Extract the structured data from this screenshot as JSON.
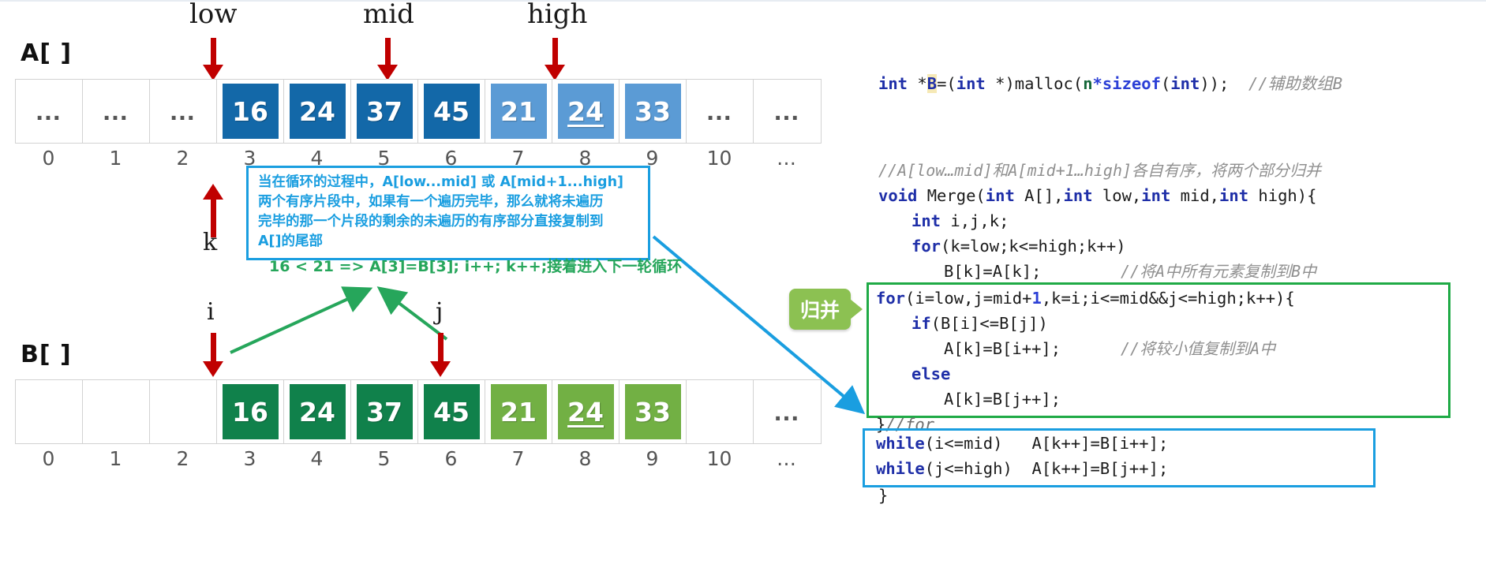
{
  "arrays": {
    "a": {
      "label": "A[ ]",
      "cells": [
        {
          "text": "…",
          "type": "dots"
        },
        {
          "text": "…",
          "type": "dots"
        },
        {
          "text": "…",
          "type": "dots"
        },
        {
          "text": "16",
          "type": "chip",
          "color": "#1368a8",
          "underline": false
        },
        {
          "text": "24",
          "type": "chip",
          "color": "#1368a8",
          "underline": false
        },
        {
          "text": "37",
          "type": "chip",
          "color": "#1368a8",
          "underline": false
        },
        {
          "text": "45",
          "type": "chip",
          "color": "#1368a8",
          "underline": false
        },
        {
          "text": "21",
          "type": "chip",
          "color": "#5b9bd5",
          "underline": false
        },
        {
          "text": "24",
          "type": "chip",
          "color": "#5b9bd5",
          "underline": true
        },
        {
          "text": "33",
          "type": "chip",
          "color": "#5b9bd5",
          "underline": false
        },
        {
          "text": "…",
          "type": "dots"
        },
        {
          "text": "…",
          "type": "dots"
        }
      ],
      "indices": [
        "0",
        "1",
        "2",
        "3",
        "4",
        "5",
        "6",
        "7",
        "8",
        "9",
        "10",
        "…"
      ]
    },
    "b": {
      "label": "B[ ]",
      "cells": [
        {
          "text": "",
          "type": "empty"
        },
        {
          "text": "",
          "type": "empty"
        },
        {
          "text": "",
          "type": "empty"
        },
        {
          "text": "16",
          "type": "chip",
          "color": "#10814b",
          "underline": false
        },
        {
          "text": "24",
          "type": "chip",
          "color": "#10814b",
          "underline": false
        },
        {
          "text": "37",
          "type": "chip",
          "color": "#10814b",
          "underline": false
        },
        {
          "text": "45",
          "type": "chip",
          "color": "#10814b",
          "underline": false
        },
        {
          "text": "21",
          "type": "chip",
          "color": "#72b044",
          "underline": false
        },
        {
          "text": "24",
          "type": "chip",
          "color": "#72b044",
          "underline": true
        },
        {
          "text": "33",
          "type": "chip",
          "color": "#72b044",
          "underline": false
        },
        {
          "text": "",
          "type": "empty"
        },
        {
          "text": "…",
          "type": "dots"
        }
      ],
      "indices": [
        "0",
        "1",
        "2",
        "3",
        "4",
        "5",
        "6",
        "7",
        "8",
        "9",
        "10",
        "…"
      ]
    }
  },
  "pointers": {
    "low": "low",
    "mid": "mid",
    "high": "high",
    "k": "k",
    "i": "i",
    "j": "j"
  },
  "notes": {
    "blue_box": {
      "line1": "当在循环的过程中，A[low...mid] 或 A[mid+1...high]",
      "line2": "两个有序片段中，如果有一个遍历完毕，那么就将未遍历",
      "line3": "完毕的那一个片段的剩余的未遍历的有序部分直接复制到",
      "line4": "A[]的尾部"
    },
    "green_equation": "16 < 21 => A[3]=B[3]; i++; k++;接着进入下一轮循环",
    "merge_tag": "归并"
  },
  "code": {
    "line_malloc": {
      "kw1": "int",
      "star_b": " *B",
      "eq": "=(",
      "kw2": "int",
      "cast": " *)malloc(",
      "n": "n",
      "mul": "*",
      "sizeof": "sizeof",
      "open": "(",
      "kw3": "int",
      "close": "));",
      "comment": " //辅助数组B"
    },
    "comment_merge": "//A[low…mid]和A[mid+1…high]各自有序，将两个部分归并",
    "sig": {
      "kw_void": "void",
      "name": " Merge(",
      "kw_int1": "int",
      "p1": " A[],",
      "kw_int2": "int",
      "p2": " low,",
      "kw_int3": "int",
      "p3": " mid,",
      "kw_int4": "int",
      "p4": " high){"
    },
    "decl": {
      "kw": "int",
      "rest": " i,j,k;"
    },
    "for_copy": {
      "kw": "for",
      "rest": "(k=low;k<=high;k++)"
    },
    "copy_body": {
      "code": "B[k]=A[k];",
      "comment": "//将A中所有元素复制到B中"
    },
    "for_merge": {
      "kw": "for",
      "a": "(i=low,j=mid+",
      "num": "1",
      "b": ",k=i;i<=mid&&j<=high;k++){"
    },
    "if_line": {
      "kw": "if",
      "rest": "(B[i]<=B[j])"
    },
    "assign_i": {
      "code": "A[k]=B[i++];",
      "comment": "//将较小值复制到A中"
    },
    "else_line": {
      "kw": "else"
    },
    "assign_j": {
      "code": "A[k]=B[j++];"
    },
    "close_for": {
      "brace": "}",
      "comment": "//for"
    },
    "while_i": {
      "kw": "while",
      "cond": "(i<=mid)",
      "body": "   A[k++]=B[i++];"
    },
    "while_j": {
      "kw": "while",
      "cond": "(j<=high)",
      "body": "  A[k++]=B[j++];"
    },
    "close_fn": "}"
  },
  "colors": {
    "dark_blue": "#1368a8",
    "light_blue": "#5b9bd5",
    "dark_green": "#10814b",
    "light_green": "#72b044",
    "red_arrow": "#c00000",
    "note_blue": "#1a9ee0",
    "note_green": "#26a65b",
    "box_green": "#1faa46",
    "tag_green": "#8cc152"
  }
}
